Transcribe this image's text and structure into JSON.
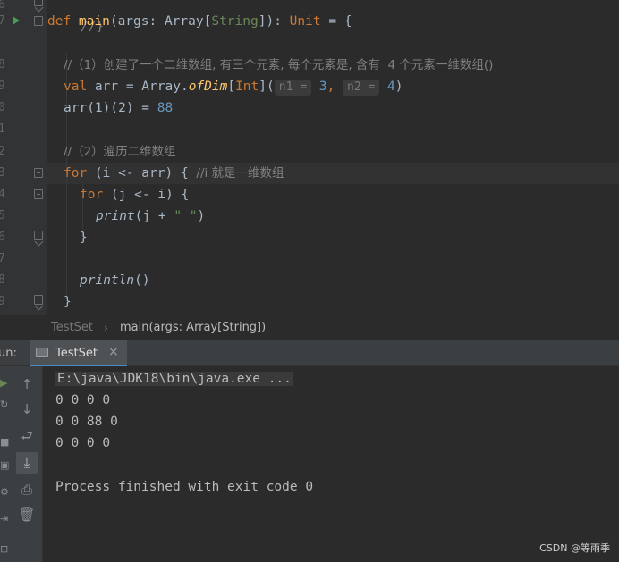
{
  "editor": {
    "line_numbers": [
      "6",
      "7",
      "8",
      "9",
      "0",
      "1",
      "2",
      "3",
      "4",
      "5",
      "6",
      "7",
      "8",
      "9"
    ],
    "lines": {
      "top_partial": "//}",
      "def_kw": "def ",
      "def_fn": "main",
      "def_args1": "(args: ",
      "def_type": "Array",
      "def_lb": "[",
      "def_tparam": "String",
      "def_rb": "]",
      "def_colon": "): ",
      "def_ret": "Unit",
      "def_end": " = {",
      "c1": "//（1）创建了一个二维数组, 有三个元素, 每个元素是, 含有  4 个元素一维数组()",
      "val_kw": "val ",
      "val_mid": "arr = Array.",
      "val_fn": "ofDim",
      "val_lb": "[",
      "val_tp": "Int",
      "val_rb": "](",
      "hint_n1": "n1 =",
      "val_3": "3",
      "val_comma": ", ",
      "hint_n2": "n2 =",
      "val_4": "4",
      "val_end": ")",
      "assign_pre": "arr(1)(2) = ",
      "assign_num": "88",
      "c2": "//（2）遍历二维数组",
      "for1_kw": "for ",
      "for1_mid": "(i <- arr) { ",
      "for1_cm": "//i 就是一维数组",
      "for2_kw": "for ",
      "for2_mid": "(j <- i) {",
      "print_fn": "print",
      "print_mid": "(j + ",
      "print_str": "\" \"",
      "print_end": ")",
      "close1": "}",
      "println": "println",
      "println_end": "()",
      "close2": "}"
    }
  },
  "breadcrumb": {
    "file": "TestSet",
    "separator": "›",
    "method": "main(args: Array[String])"
  },
  "run": {
    "label": "un:",
    "tab_label": "TestSet",
    "tab_close": "×",
    "tools": {
      "up": "↑",
      "down": "↓",
      "wrap": "⮐",
      "scroll": "⤓",
      "print": "⎙",
      "trash": "🗑"
    },
    "console": {
      "cmd": "E:\\java\\JDK18\\bin\\java.exe ...",
      "out1": "0 0 0 0",
      "out2": "0 0 88 0",
      "out3": "0 0 0 0",
      "finish": "Process finished with exit code 0"
    }
  },
  "watermark": "CSDN @等雨季"
}
